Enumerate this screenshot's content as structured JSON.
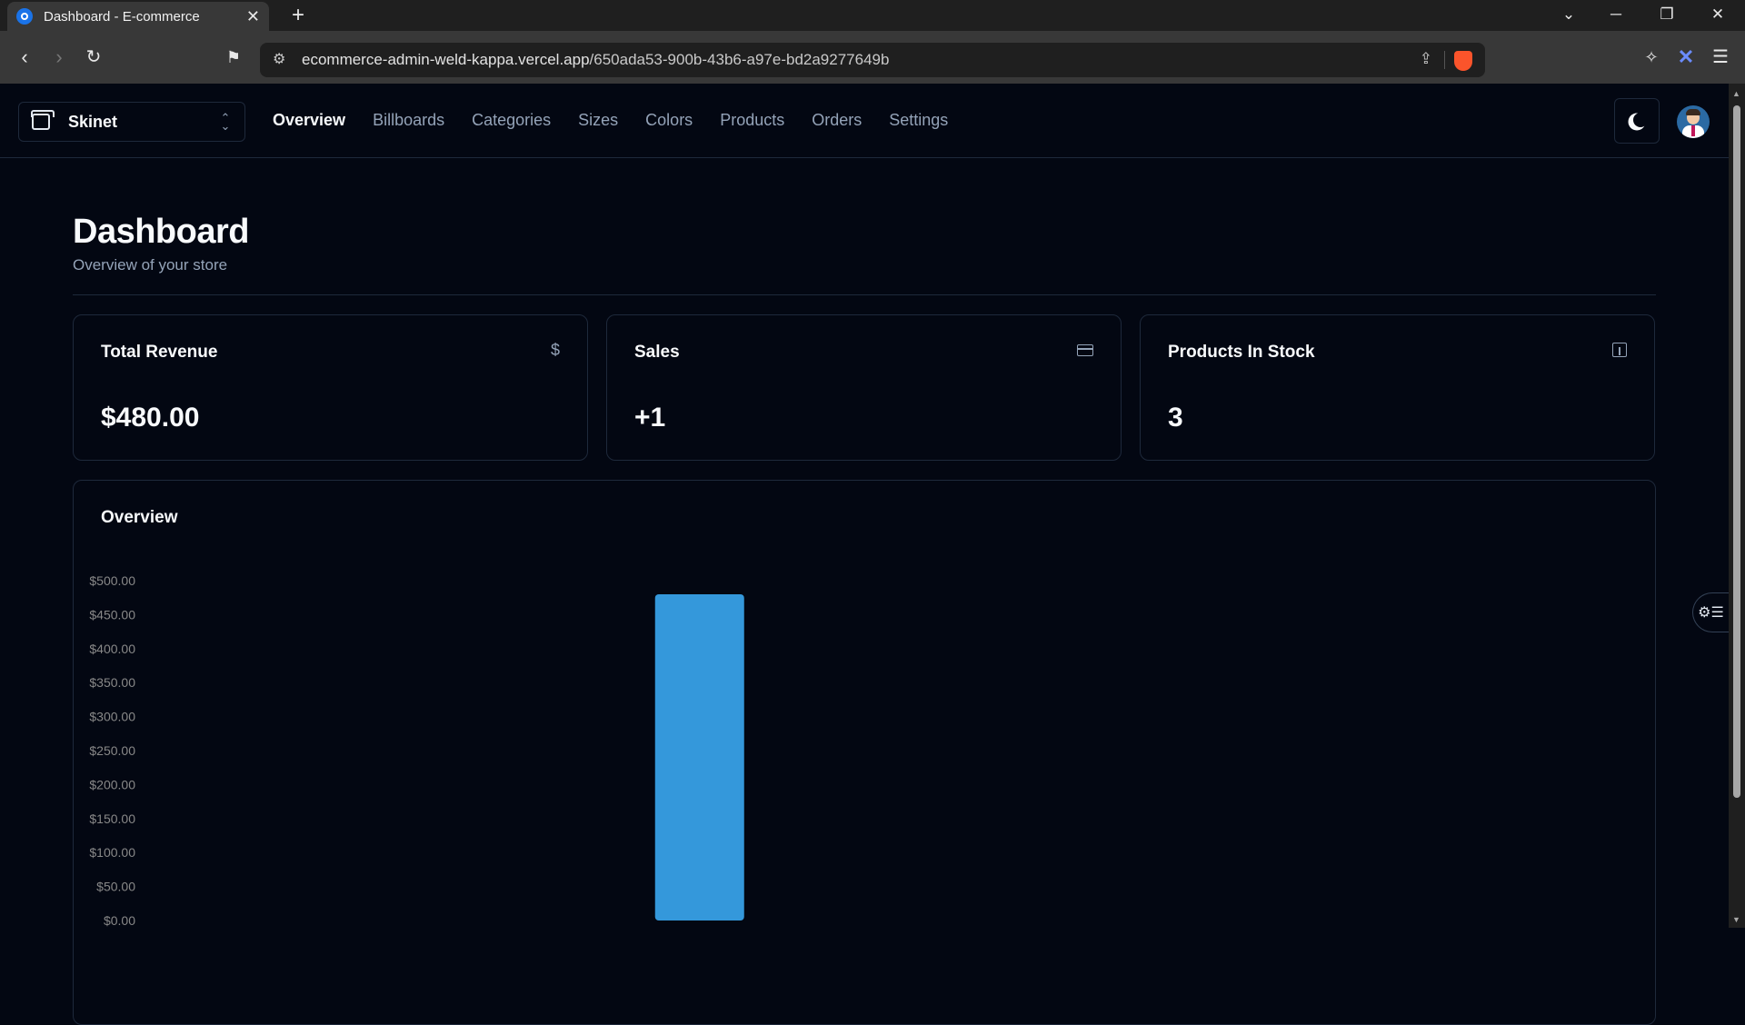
{
  "browser": {
    "tab_title": "Dashboard - E-commerce",
    "url_host": "ecommerce-admin-weld-kappa.vercel.app",
    "url_path": "/650ada53-900b-43b6-a97e-bd2a9277649b"
  },
  "nav": {
    "store_name": "Skinet",
    "links": [
      "Overview",
      "Billboards",
      "Categories",
      "Sizes",
      "Colors",
      "Products",
      "Orders",
      "Settings"
    ],
    "active": "Overview"
  },
  "page": {
    "title": "Dashboard",
    "subtitle": "Overview of your store"
  },
  "cards": [
    {
      "title": "Total Revenue",
      "value": "$480.00",
      "icon": "dollar-icon"
    },
    {
      "title": "Sales",
      "value": "+1",
      "icon": "credit-card-icon"
    },
    {
      "title": "Products In Stock",
      "value": "3",
      "icon": "package-icon"
    }
  ],
  "overview": {
    "title": "Overview"
  },
  "colors": {
    "bar": "#3498db",
    "background": "#030712",
    "border": "#1e293b"
  },
  "chart_data": {
    "type": "bar",
    "categories": [
      "",
      "",
      "",
      "",
      "",
      "",
      "",
      "",
      "",
      "",
      "",
      ""
    ],
    "values": [
      0,
      0,
      0,
      0,
      480,
      0,
      0,
      0,
      0,
      0,
      0,
      0
    ],
    "ylim": [
      0,
      500
    ],
    "yticks": [
      "$0.00",
      "$50.00",
      "$100.00",
      "$150.00",
      "$200.00",
      "$250.00",
      "$300.00",
      "$350.00",
      "$400.00",
      "$450.00",
      "$500.00"
    ],
    "title": "",
    "xlabel": "",
    "ylabel": ""
  }
}
